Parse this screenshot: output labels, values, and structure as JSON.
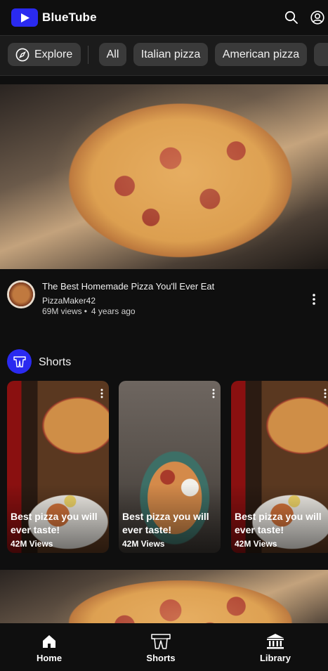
{
  "app": {
    "title": "BlueTube"
  },
  "header": {
    "search_icon": "search-icon",
    "account_icon": "account-icon"
  },
  "chips": {
    "explore_label": "Explore",
    "items": [
      {
        "label": "All"
      },
      {
        "label": "Italian pizza"
      },
      {
        "label": "American pizza"
      }
    ]
  },
  "video": {
    "title": "The Best Homemade Pizza You'll Ever Eat",
    "channel": "PizzaMaker42",
    "views": "69M views",
    "age": "4 years ago"
  },
  "shorts": {
    "label": "Shorts",
    "items": [
      {
        "title": "Best pizza you will ever taste!",
        "views": "42M Views"
      },
      {
        "title": "Best pizza you will ever taste!",
        "views": "42M Views"
      },
      {
        "title": "Best pizza you will ever taste!",
        "views": "42M Views"
      }
    ]
  },
  "nav": {
    "home": "Home",
    "shorts": "Shorts",
    "library": "Library"
  },
  "colors": {
    "brand": "#2a2af0",
    "background": "#0f0f0f",
    "chip": "#3a3a3a"
  }
}
